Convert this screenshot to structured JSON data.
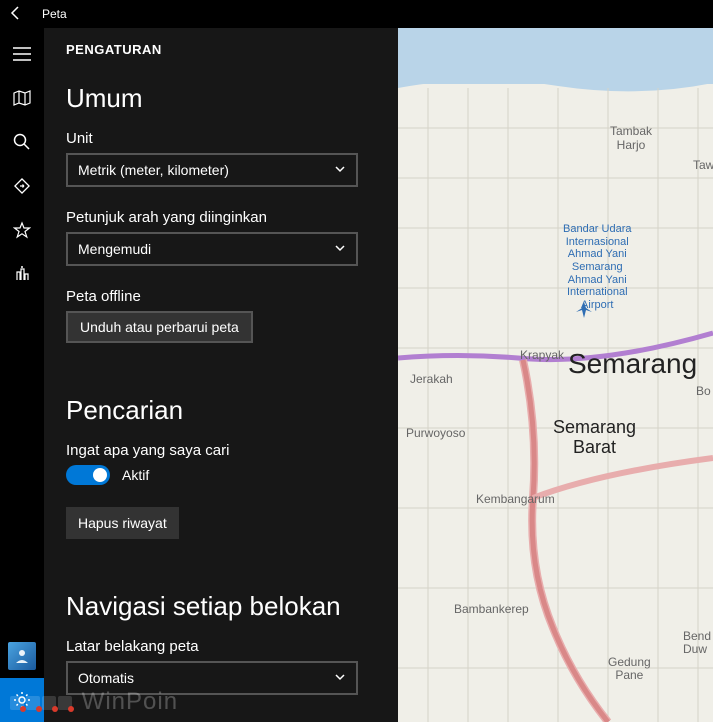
{
  "app": {
    "title": "Peta"
  },
  "panel": {
    "title": "PENGATURAN",
    "sections": {
      "general": {
        "heading": "Umum",
        "unit_label": "Unit",
        "unit_value": "Metrik (meter, kilometer)",
        "directions_label": "Petunjuk arah yang diinginkan",
        "directions_value": "Mengemudi",
        "offline_label": "Peta offline",
        "offline_button": "Unduh atau perbarui peta"
      },
      "search": {
        "heading": "Pencarian",
        "remember_label": "Ingat apa yang saya cari",
        "toggle_state": "Aktif",
        "clear_button": "Hapus riwayat"
      },
      "nav": {
        "heading": "Navigasi setiap belokan",
        "bg_label": "Latar belakang peta",
        "bg_value": "Otomatis"
      }
    }
  },
  "map": {
    "places": {
      "semarang": "Semarang",
      "semarang_barat": "Semarang\nBarat",
      "tambak_harjo": "Tambak\nHarjo",
      "tawa": "Tawa",
      "krapyak": "Krapyak",
      "jerakah": "Jerakah",
      "purwoyoso": "Purwoyoso",
      "kembangarum": "Kembangarum",
      "bambankerep": "Bambankerep",
      "gedung": "Gedung\nPane",
      "bend": "Bend\nDuw",
      "bo": "Bo",
      "airport": "Bandar Udara\nInternasional\nAhmad Yani\nSemarang\nAhmad Yani\nInternational\nAirport"
    }
  },
  "watermark": "WinPoin"
}
